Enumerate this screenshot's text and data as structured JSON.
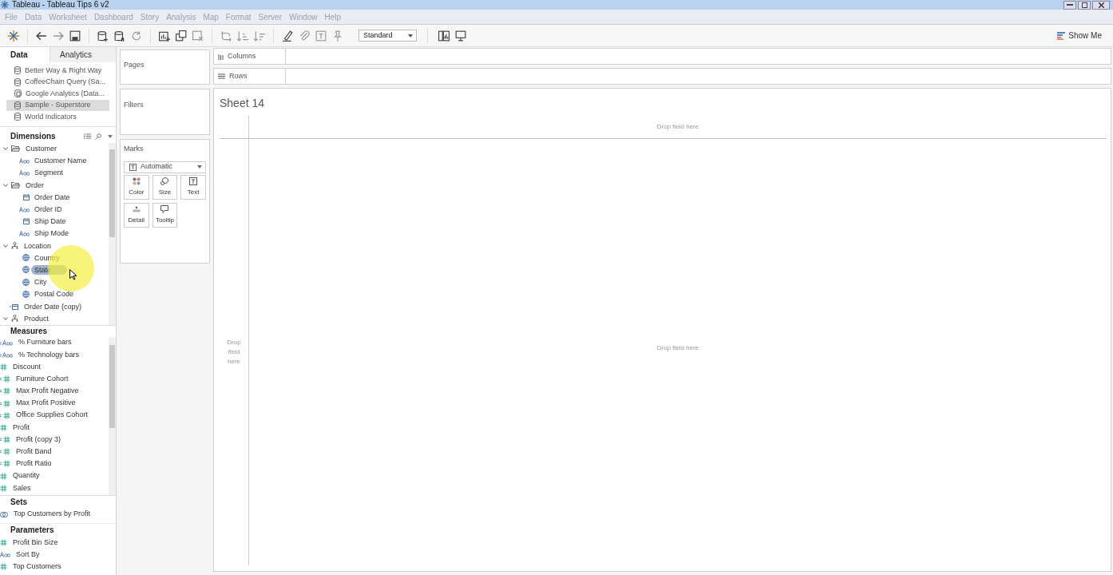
{
  "window": {
    "title": "Tableau - Tableau Tips 6 v2"
  },
  "menu": [
    "File",
    "Data",
    "Worksheet",
    "Dashboard",
    "Story",
    "Analysis",
    "Map",
    "Format",
    "Server",
    "Window",
    "Help"
  ],
  "toolbar": {
    "fit": "Standard",
    "show_me": "Show Me"
  },
  "side_tabs": [
    {
      "label": "Data",
      "selected": true
    },
    {
      "label": "Analytics",
      "selected": false
    }
  ],
  "data_sources": [
    {
      "name": "Better Way &  Right Way",
      "kind": "db",
      "selected": false
    },
    {
      "name": "CoffeeChain Query (Sa...",
      "kind": "db",
      "selected": false
    },
    {
      "name": "Google Analytics (Data...",
      "kind": "multi",
      "selected": false
    },
    {
      "name": "Sample - Superstore",
      "kind": "db",
      "selected": true
    },
    {
      "name": "World Indicators",
      "kind": "db",
      "selected": false
    }
  ],
  "dimensions": {
    "title": "Dimensions",
    "items": [
      {
        "name": "Customer",
        "kind": "folder",
        "expanded": true,
        "selected": false,
        "children": [
          {
            "name": "Customer Name",
            "kind": "abc",
            "selected": false
          },
          {
            "name": "Segment",
            "kind": "abc",
            "selected": false
          }
        ]
      },
      {
        "name": "Order",
        "kind": "folder",
        "expanded": true,
        "selected": false,
        "children": [
          {
            "name": "Order Date",
            "kind": "date",
            "selected": false
          },
          {
            "name": "Order ID",
            "kind": "abc",
            "selected": false
          },
          {
            "name": "Ship Date",
            "kind": "date",
            "selected": false
          },
          {
            "name": "Ship Mode",
            "kind": "abc",
            "selected": false
          }
        ]
      },
      {
        "name": "Location",
        "kind": "hierarchy",
        "expanded": true,
        "selected": false,
        "children": [
          {
            "name": "Country",
            "kind": "geo",
            "selected": false
          },
          {
            "name": "State",
            "kind": "geo",
            "selected": true
          },
          {
            "name": "City",
            "kind": "geo",
            "selected": false
          },
          {
            "name": "Postal Code",
            "kind": "geo",
            "selected": false
          }
        ]
      },
      {
        "name": "Order Date (copy)",
        "kind": "calc-date",
        "selected": false
      },
      {
        "name": "Product",
        "kind": "hierarchy",
        "expanded": true,
        "selected": false
      }
    ]
  },
  "measures": {
    "title": "Measures",
    "items": [
      {
        "name": "% Furniture bars",
        "kind": "calc-abc"
      },
      {
        "name": "% Technology bars",
        "kind": "calc-abc"
      },
      {
        "name": "Discount",
        "kind": "num"
      },
      {
        "name": "Furniture Cohort",
        "kind": "calc-num"
      },
      {
        "name": "Max Profit Negative",
        "kind": "calc-num"
      },
      {
        "name": "Max Profit Positive",
        "kind": "calc-num"
      },
      {
        "name": "Office Supplies Cohort",
        "kind": "calc-num"
      },
      {
        "name": "Profit",
        "kind": "num"
      },
      {
        "name": "Profit (copy 3)",
        "kind": "calc-num"
      },
      {
        "name": "Profit Band",
        "kind": "calc-num"
      },
      {
        "name": "Profit Ratio",
        "kind": "calc-num"
      },
      {
        "name": "Quantity",
        "kind": "num"
      },
      {
        "name": "Sales",
        "kind": "num"
      }
    ]
  },
  "sets": {
    "title": "Sets",
    "items": [
      {
        "name": "Top Customers by Profit",
        "kind": "set"
      }
    ]
  },
  "parameters": {
    "title": "Parameters",
    "items": [
      {
        "name": "Profit Bin Size",
        "kind": "num"
      },
      {
        "name": "Sort By",
        "kind": "abc"
      },
      {
        "name": "Top Customers",
        "kind": "num"
      }
    ]
  },
  "pages": {
    "title": "Pages"
  },
  "filters": {
    "title": "Filters"
  },
  "marks": {
    "title": "Marks",
    "mark_type": "Automatic",
    "cards": [
      {
        "label": "Color",
        "kind": "color"
      },
      {
        "label": "Size",
        "kind": "size"
      },
      {
        "label": "Text",
        "kind": "text"
      },
      {
        "label": "Detail",
        "kind": "detail"
      },
      {
        "label": "Tooltip",
        "kind": "tooltip"
      }
    ]
  },
  "columns": {
    "title": "Columns"
  },
  "rows": {
    "title": "Rows"
  },
  "sheet": {
    "title": "Sheet 14",
    "drop_top": "Drop field here",
    "drop_left": "Drop field here",
    "drop_center": "Drop field here"
  }
}
